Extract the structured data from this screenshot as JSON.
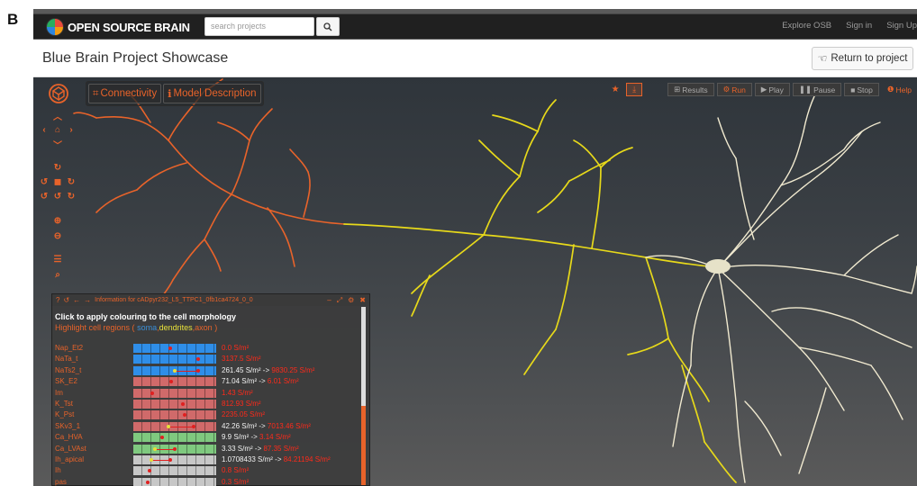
{
  "panel_label": "B",
  "navbar": {
    "logo_text": "OPEN SOURCE BRAIN",
    "search_placeholder": "search projects",
    "links": [
      "Explore OSB",
      "Sign in",
      "Sign Up"
    ]
  },
  "titlebar": {
    "title": "Blue Brain Project Showcase",
    "return_label": "Return to project"
  },
  "viewer": {
    "tabs": [
      "Connectivity",
      "Model Description"
    ],
    "toolbar": [
      "Results",
      "Run",
      "Play",
      "Pause",
      "Stop",
      "Help"
    ]
  },
  "info_panel": {
    "title": "Information for cADpyr232_L5_TTPC1_0fb1ca4724_0_0",
    "heading": "Click to apply colouring to the cell morphology",
    "highlight_prefix": "Highlight cell regions (",
    "region_soma": "soma",
    "region_dendrites": "dendrites",
    "region_axon": "axon",
    "highlight_suffix": ")",
    "channels": [
      {
        "name": "Nap_Et2",
        "color": "#2f8ee8",
        "dots": [
          0.45
        ],
        "value_white": "",
        "value_red": "0.0 S/m²"
      },
      {
        "name": "NaTa_t",
        "color": "#2f8ee8",
        "dots": [
          0.78
        ],
        "value_white": "",
        "value_red": "3137.5 S/m²"
      },
      {
        "name": "NaTs2_t",
        "color": "#2f8ee8",
        "dots": [
          0.5,
          0.78
        ],
        "value_white": "261.45 S/m² ->",
        "value_red": "9830.25 S/m²"
      },
      {
        "name": "SK_E2",
        "color": "#d06a6a",
        "dots": [
          0.46
        ],
        "value_white": "71.04 S/m² ->",
        "value_red": "6.01 S/m²"
      },
      {
        "name": "Im",
        "color": "#d06a6a",
        "dots": [
          0.23
        ],
        "value_white": "",
        "value_red": "1.43 S/m²"
      },
      {
        "name": "K_Tst",
        "color": "#d06a6a",
        "dots": [
          0.6
        ],
        "value_white": "",
        "value_red": "812.93 S/m²"
      },
      {
        "name": "K_Pst",
        "color": "#d06a6a",
        "dots": [
          0.62
        ],
        "value_white": "",
        "value_red": "2235.05 S/m²"
      },
      {
        "name": "SKv3_1",
        "color": "#d06a6a",
        "dots": [
          0.42,
          0.73
        ],
        "value_white": "42.26 S/m² ->",
        "value_red": "7013.46 S/m²"
      },
      {
        "name": "Ca_HVA",
        "color": "#7fc97f",
        "dots": [
          0.35
        ],
        "value_white": "9.9 S/m² ->",
        "value_red": "3.14 S/m²"
      },
      {
        "name": "Ca_LVAst",
        "color": "#7fc97f",
        "dots": [
          0.26,
          0.5
        ],
        "value_white": "3.33 S/m² ->",
        "value_red": "87.35 S/m²"
      },
      {
        "name": "Ih_apical",
        "color": "#c7c7c7",
        "dots": [
          0.22,
          0.45
        ],
        "value_white": "1.0708433 S/m² ->",
        "value_red": "84.21194 S/m²"
      },
      {
        "name": "Ih",
        "color": "#c7c7c7",
        "dots": [
          0.2
        ],
        "value_white": "",
        "value_red": "0.8 S/m²"
      },
      {
        "name": "pas",
        "color": "#c7c7c7",
        "dots": [
          0.17
        ],
        "value_white": "",
        "value_red": "0.3 S/m²"
      }
    ]
  },
  "colors": {
    "accent": "#e8632a",
    "axon": "#e8632a",
    "dendrite_apical": "#e7d91a",
    "dendrite_basal": "#f1ead0",
    "soma": "#e6e2c8"
  }
}
